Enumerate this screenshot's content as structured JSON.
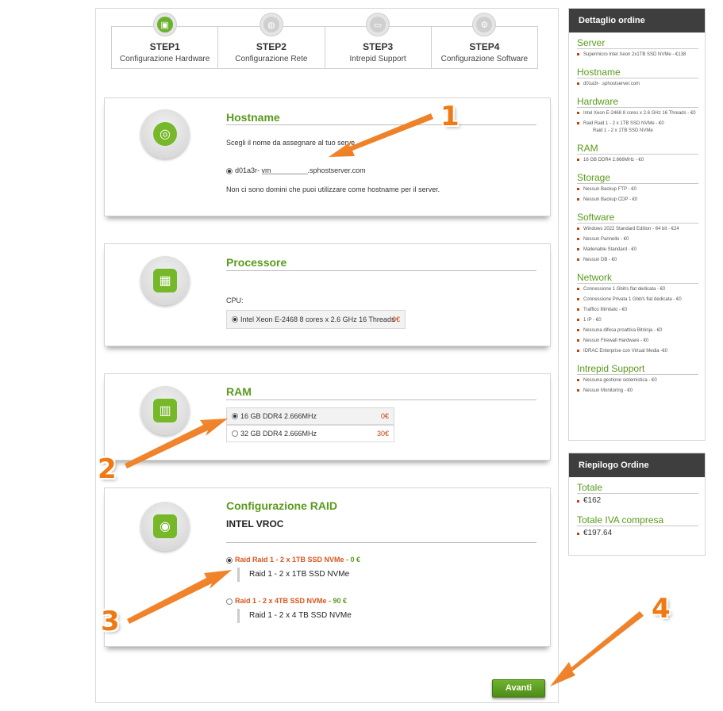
{
  "steps": [
    {
      "title": "STEP1",
      "sub": "Configurazione Hardware"
    },
    {
      "title": "STEP2",
      "sub": "Configurazione Rete"
    },
    {
      "title": "STEP3",
      "sub": "Intrepid Support"
    },
    {
      "title": "STEP4",
      "sub": "Configurazione Software"
    }
  ],
  "hostname": {
    "title": "Hostname",
    "prompt": "Scegli il nome da assegnare al tuo serve",
    "prefix": "d01a3r-",
    "value": "vm",
    "suffix": ".sphostserver.com",
    "note": "Non ci sono domini che puoi utilizzare come hostname per il server."
  },
  "processor": {
    "title": "Processore",
    "label": "CPU:",
    "option": "Intel Xeon E-2468 8 cores x 2.6 GHz 16 Threads",
    "price": "0€"
  },
  "ram": {
    "title": "RAM",
    "options": [
      {
        "label": "16 GB DDR4 2.666MHz",
        "price": "0€"
      },
      {
        "label": "32 GB DDR4 2.666MHz",
        "price": "30€"
      }
    ]
  },
  "raid": {
    "title": "Configurazione RAID",
    "subtitle": "INTEL VROC",
    "options": [
      {
        "label": "Raid Raid 1 - 2 x 1TB SSD NVMe - ",
        "price": "0 €",
        "detail": "Raid 1 - 2 x 1TB SSD NVMe"
      },
      {
        "label": "Raid 1 - 2 x 4TB SSD NVMe - ",
        "price": "90 €",
        "detail": "Raid 1 - 2 x 4 TB SSD NVMe"
      }
    ]
  },
  "button": {
    "label": "Avanti"
  },
  "annotations": [
    "1",
    "2",
    "3",
    "4"
  ],
  "order": {
    "title": "Dettaglio ordine",
    "sections": [
      {
        "name": "Server",
        "items": [
          "Supermicro Intel Xeon 2x1TB SSD NVMe - €138"
        ]
      },
      {
        "name": "Hostname",
        "items": [
          "d01a3r- .sphostserver.com"
        ]
      },
      {
        "name": "Hardware",
        "items": [
          "Intel Xeon E-2468 8 cores x 2.6 GHz 16 Threads - €0",
          "Raid Raid 1 - 2 x 1TB SSD NVMe - €0"
        ],
        "sub": "Raid 1 - 2 x 1TB SSD NVMe"
      },
      {
        "name": "RAM",
        "items": [
          "16 GB DDR4 2.666MHz - €0"
        ]
      },
      {
        "name": "Storage",
        "items": [
          "Nessun Backup FTP - €0",
          "Nessun Backup CDP - €0"
        ]
      },
      {
        "name": "Software",
        "items": [
          "Windows 2022 Standard Edition - 64 bit - €24",
          "Nessun Pannello - €0",
          "Mailenable Standard - €0",
          "Nessun DB - €0"
        ]
      },
      {
        "name": "Network",
        "items": [
          "Connessione 1 Gbit/s flat dedicata - €0",
          "Connessione Privata 1 Gbit/s flat dedicata - €0",
          "Traffico Illimitato - €0",
          "1 IP - €0",
          "Nessuna difesa proattiva Bitninja - €0",
          "Nessun Firewall Hardware - €0",
          "IDRAC Enterprise con Virtual Media -€0"
        ]
      },
      {
        "name": "Intrepid Support",
        "items": [
          "Nessuna gestione sistemistica - €0",
          "Nessun Monitoring - €0"
        ]
      }
    ]
  },
  "summary": {
    "title": "Riepilogo Ordine",
    "total_label": "Totale",
    "total": "€162",
    "total_vat_label": "Totale IVA compresa",
    "total_vat": "€197.64"
  },
  "colors": {
    "accent": "#5a9a1c",
    "price": "#c0400b",
    "arrow": "#ef7a12"
  }
}
